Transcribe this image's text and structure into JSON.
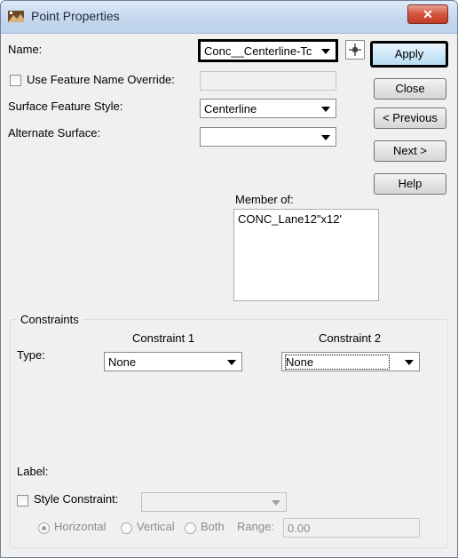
{
  "window": {
    "title": "Point Properties",
    "close_glyph": "✕"
  },
  "fields": {
    "name_label": "Name:",
    "name_value": "Conc__Centerline-Tc",
    "use_override_label": "Use Feature Name Override:",
    "override_value": "",
    "surface_style_label": "Surface Feature Style:",
    "surface_style_value": "Centerline",
    "alternate_surface_label": "Alternate Surface:",
    "alternate_surface_value": "",
    "member_of_label": "Member of:",
    "member_of_items": [
      "CONC_Lane12\"x12'"
    ]
  },
  "buttons": {
    "apply": "Apply",
    "close": "Close",
    "previous": "< Previous",
    "next": "Next >",
    "help": "Help"
  },
  "constraints": {
    "group_title": "Constraints",
    "constraint1_header": "Constraint 1",
    "constraint2_header": "Constraint 2",
    "type_label": "Type:",
    "type1_value": "None",
    "type2_value": "None",
    "label_label": "Label:",
    "style_constraint_label": "Style Constraint:",
    "style_constraint_value": "",
    "horizontal_label": "Horizontal",
    "vertical_label": "Vertical",
    "both_label": "Both",
    "range_label": "Range:",
    "range_value": "0.00"
  },
  "icons": {
    "title_icon": "point-properties-icon",
    "pick_icon": "pick-point-icon"
  }
}
